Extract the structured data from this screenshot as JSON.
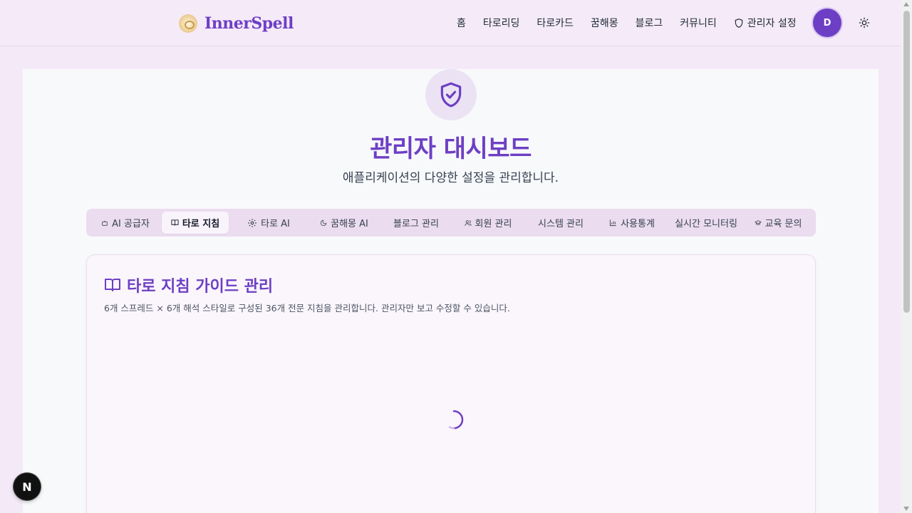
{
  "header": {
    "brand": "InnerSpell",
    "nav": [
      {
        "label": "홈"
      },
      {
        "label": "타로리딩"
      },
      {
        "label": "타로카드"
      },
      {
        "label": "꿈해몽"
      },
      {
        "label": "블로그"
      },
      {
        "label": "커뮤니티"
      },
      {
        "label": "관리자 설정"
      }
    ],
    "avatar_initial": "D"
  },
  "main": {
    "title": "관리자 대시보드",
    "subtitle": "애플리케이션의 다양한 설정을 관리합니다.",
    "tabs": [
      {
        "label": "AI 공급자",
        "icon": "bot-icon"
      },
      {
        "label": "타로 지침",
        "icon": "book-open-icon",
        "active": true
      },
      {
        "label": "타로 AI",
        "icon": "gear-icon"
      },
      {
        "label": "꿈해몽 AI",
        "icon": "moon-icon"
      },
      {
        "label": "블로그 관리",
        "icon": ""
      },
      {
        "label": "회원 관리",
        "icon": "users-icon"
      },
      {
        "label": "시스템 관리",
        "icon": ""
      },
      {
        "label": "사용통계",
        "icon": "bar-chart-icon"
      },
      {
        "label": "실시간 모니터링",
        "icon": ""
      },
      {
        "label": "교육 문의",
        "icon": "graduation-cap-icon"
      }
    ],
    "card": {
      "title": "타로 지침 가이드 관리",
      "description": "6개 스프레드 × 6개 해석 스타일로 구성된 36개 전문 지침을 관리합니다. 관리자만 보고 수정할 수 있습니다."
    }
  },
  "dev_badge": "N",
  "colors": {
    "accent": "#6d3fc4",
    "background": "#f4e9f7",
    "tab_bar": "#ebdcef"
  }
}
